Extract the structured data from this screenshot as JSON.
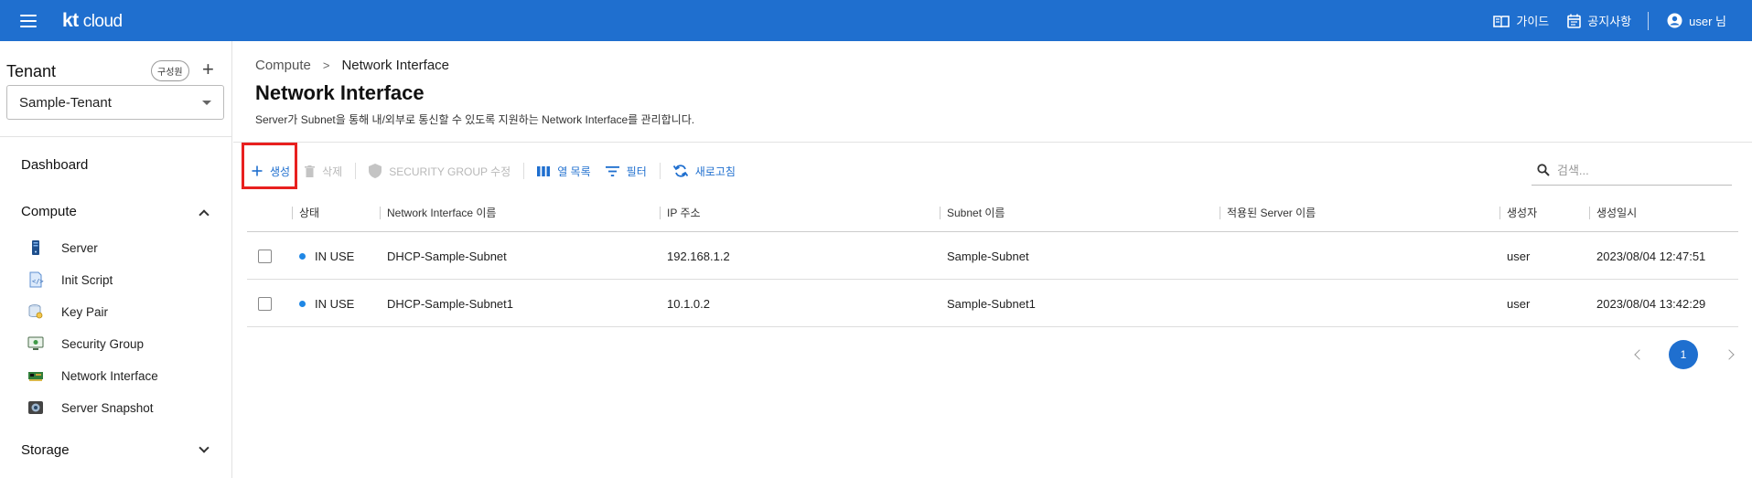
{
  "header": {
    "logo_kt": "kt",
    "logo_cloud": "cloud",
    "guide_label": "가이드",
    "notice_label": "공지사항",
    "user_label": "user 님",
    "brand_color": "#1f6fcf"
  },
  "sidebar": {
    "tenant_title": "Tenant",
    "members_label": "구성원",
    "add_label": "+",
    "tenant_selected": "Sample-Tenant",
    "dashboard_label": "Dashboard",
    "compute_label": "Compute",
    "storage_label": "Storage",
    "compute_items": [
      {
        "label": "Server",
        "icon": "server-icon"
      },
      {
        "label": "Init Script",
        "icon": "script-icon"
      },
      {
        "label": "Key Pair",
        "icon": "key-pair-icon"
      },
      {
        "label": "Security Group",
        "icon": "security-group-icon"
      },
      {
        "label": "Network Interface",
        "icon": "network-card-icon"
      },
      {
        "label": "Server Snapshot",
        "icon": "snapshot-icon"
      }
    ]
  },
  "main": {
    "breadcrumb": {
      "parent": "Compute",
      "separator": ">",
      "current": "Network Interface"
    },
    "title": "Network Interface",
    "description": "Server가 Subnet을 통해 내/외부로 통신할 수 있도록 지원하는 Network Interface를 관리합니다.",
    "toolbar": {
      "create_label": "생성",
      "delete_label": "삭제",
      "security_group_label": "SECURITY GROUP 수정",
      "columns_label": "열 목록",
      "filter_label": "필터",
      "refresh_label": "새로고침"
    },
    "search": {
      "placeholder": "검색..."
    },
    "table": {
      "columns": [
        "상태",
        "Network Interface 이름",
        "IP 주소",
        "Subnet 이름",
        "적용된 Server 이름",
        "생성자",
        "생성일시"
      ],
      "rows": [
        {
          "status": "IN USE",
          "name": "DHCP-Sample-Subnet",
          "ip": "192.168.1.2",
          "subnet": "Sample-Subnet",
          "server": "",
          "creator": "user",
          "created": "2023/08/04 12:47:51"
        },
        {
          "status": "IN USE",
          "name": "DHCP-Sample-Subnet1",
          "ip": "10.1.0.2",
          "subnet": "Sample-Subnet1",
          "server": "",
          "creator": "user",
          "created": "2023/08/04 13:42:29"
        }
      ]
    },
    "pagination": {
      "current_page": "1"
    }
  }
}
